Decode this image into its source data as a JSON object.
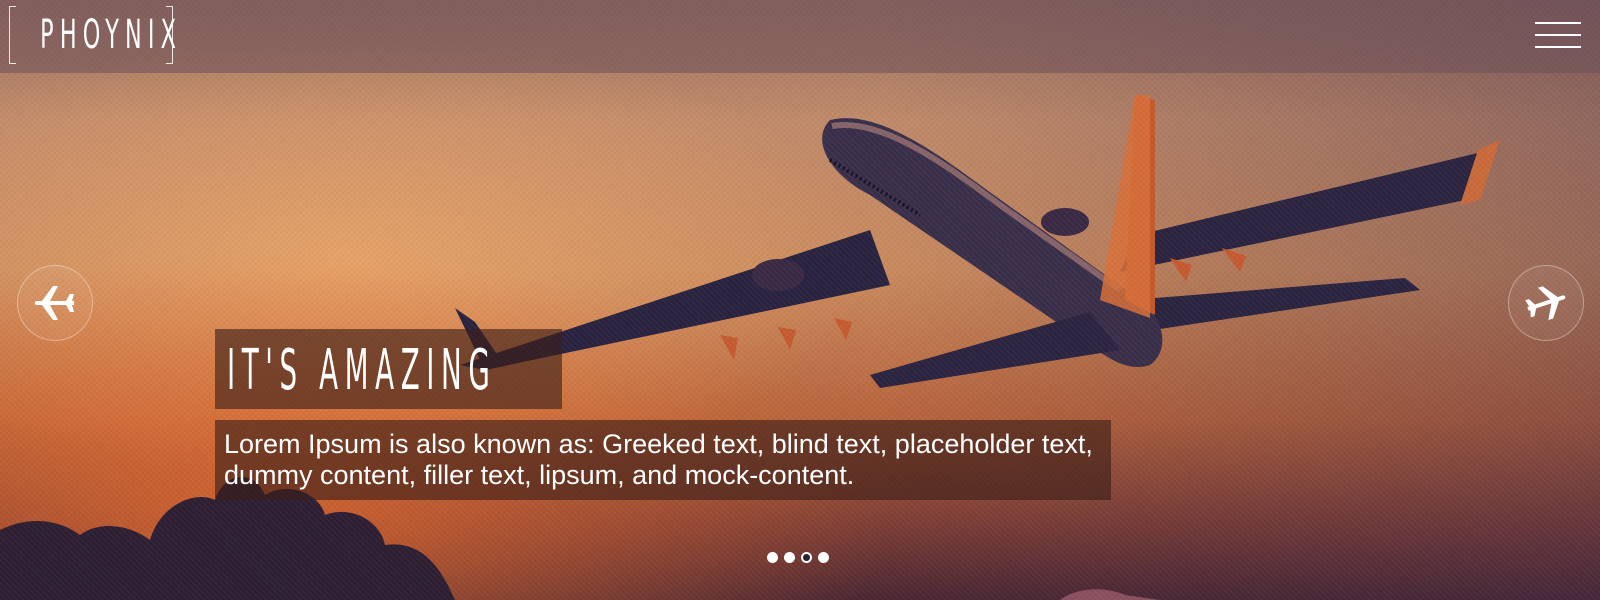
{
  "brand": {
    "logo_text": "PHOYNIX"
  },
  "header": {
    "menu_icon": "hamburger-menu-icon"
  },
  "slider": {
    "prev_icon": "airplane-left-icon",
    "next_icon": "airplane-right-icon",
    "slide": {
      "title": "IT'S AMAZING",
      "text": "Lorem Ipsum is also known as: Greeked text, blind text, placeholder text, dummy content, filler text, lipsum, and mock-content.",
      "image": "airplane-sunset-image"
    },
    "dots": [
      {
        "active": false
      },
      {
        "active": false
      },
      {
        "active": true
      },
      {
        "active": false
      }
    ]
  },
  "colors": {
    "caption_bg": "#3c1e19",
    "accent": "#ffffff"
  }
}
